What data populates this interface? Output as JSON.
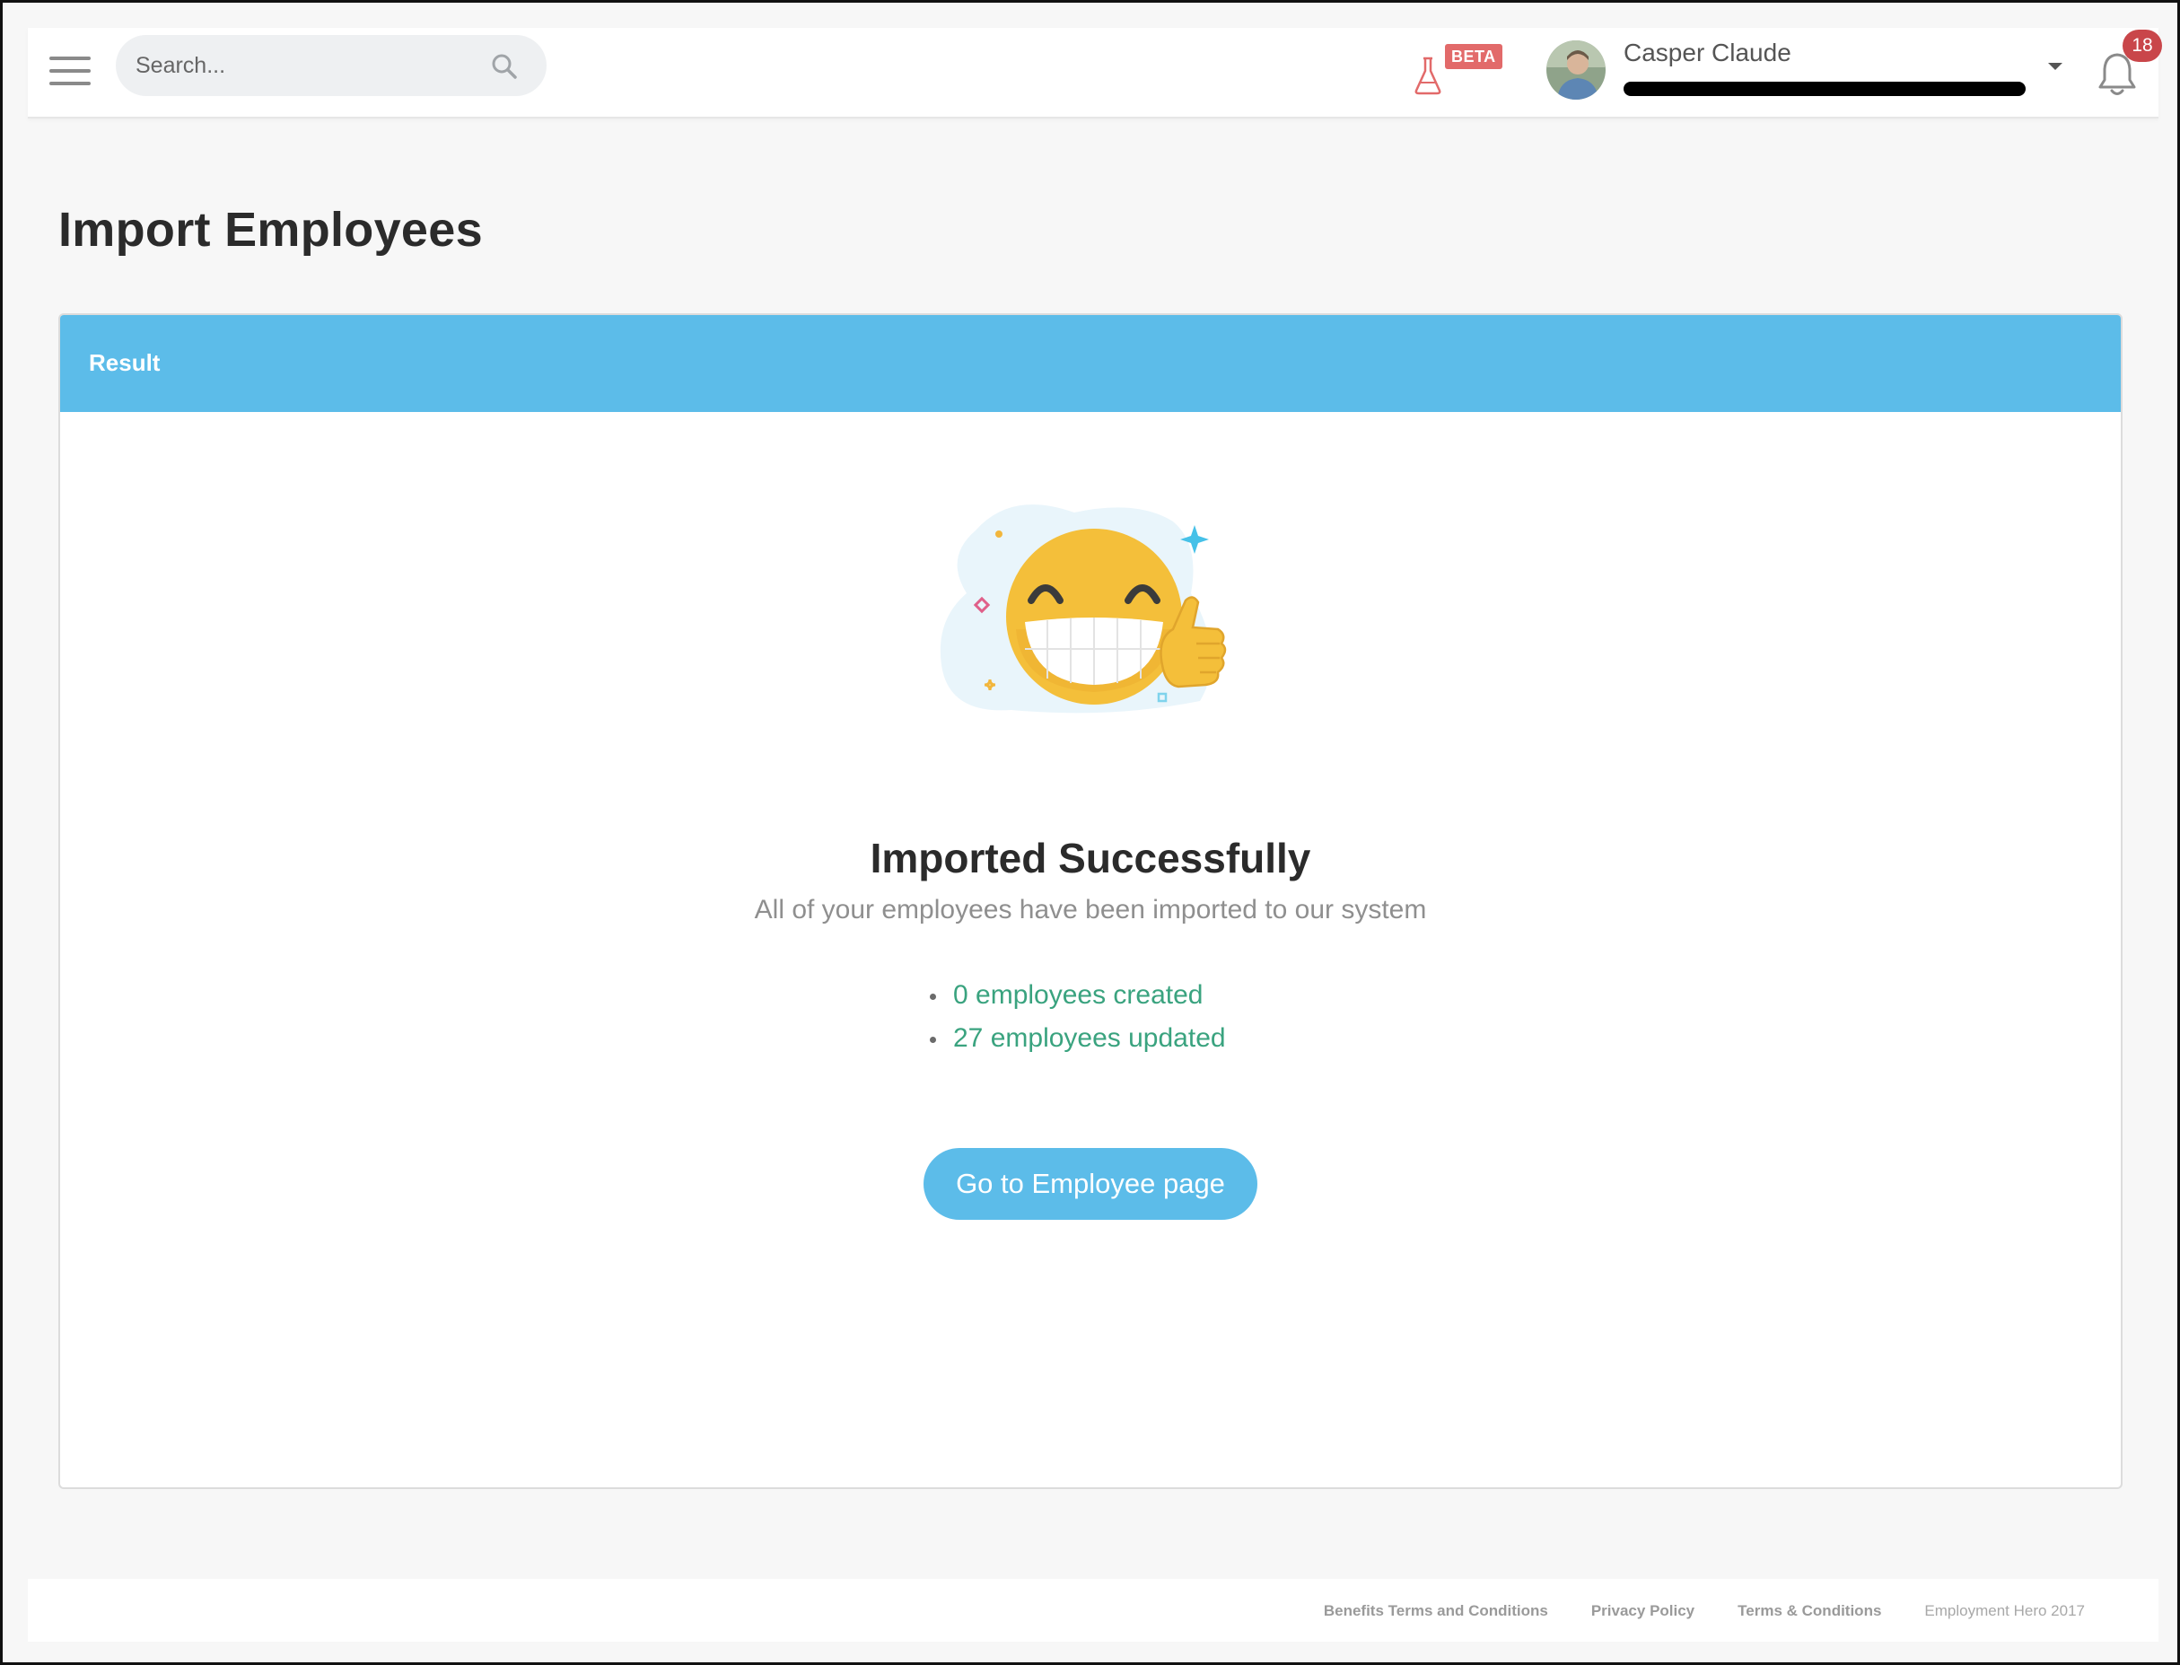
{
  "header": {
    "search_placeholder": "Search...",
    "beta_label": "BETA",
    "user_name": "Casper Claude",
    "notification_count": "18"
  },
  "page": {
    "title": "Import Employees"
  },
  "card": {
    "header_title": "Result",
    "result_title": "Imported Successfully",
    "result_subtitle": "All of your employees have been imported to our system",
    "stats": [
      "0 employees created",
      "27 employees updated"
    ],
    "button_label": "Go to Employee page"
  },
  "footer": {
    "links": [
      "Benefits Terms and Conditions",
      "Privacy Policy",
      "Terms & Conditions"
    ],
    "copyright": "Employment Hero 2017"
  },
  "colors": {
    "accent": "#5cbce9",
    "success_text": "#3aa37f",
    "badge": "#c9464a",
    "beta": "#e26a6a"
  }
}
